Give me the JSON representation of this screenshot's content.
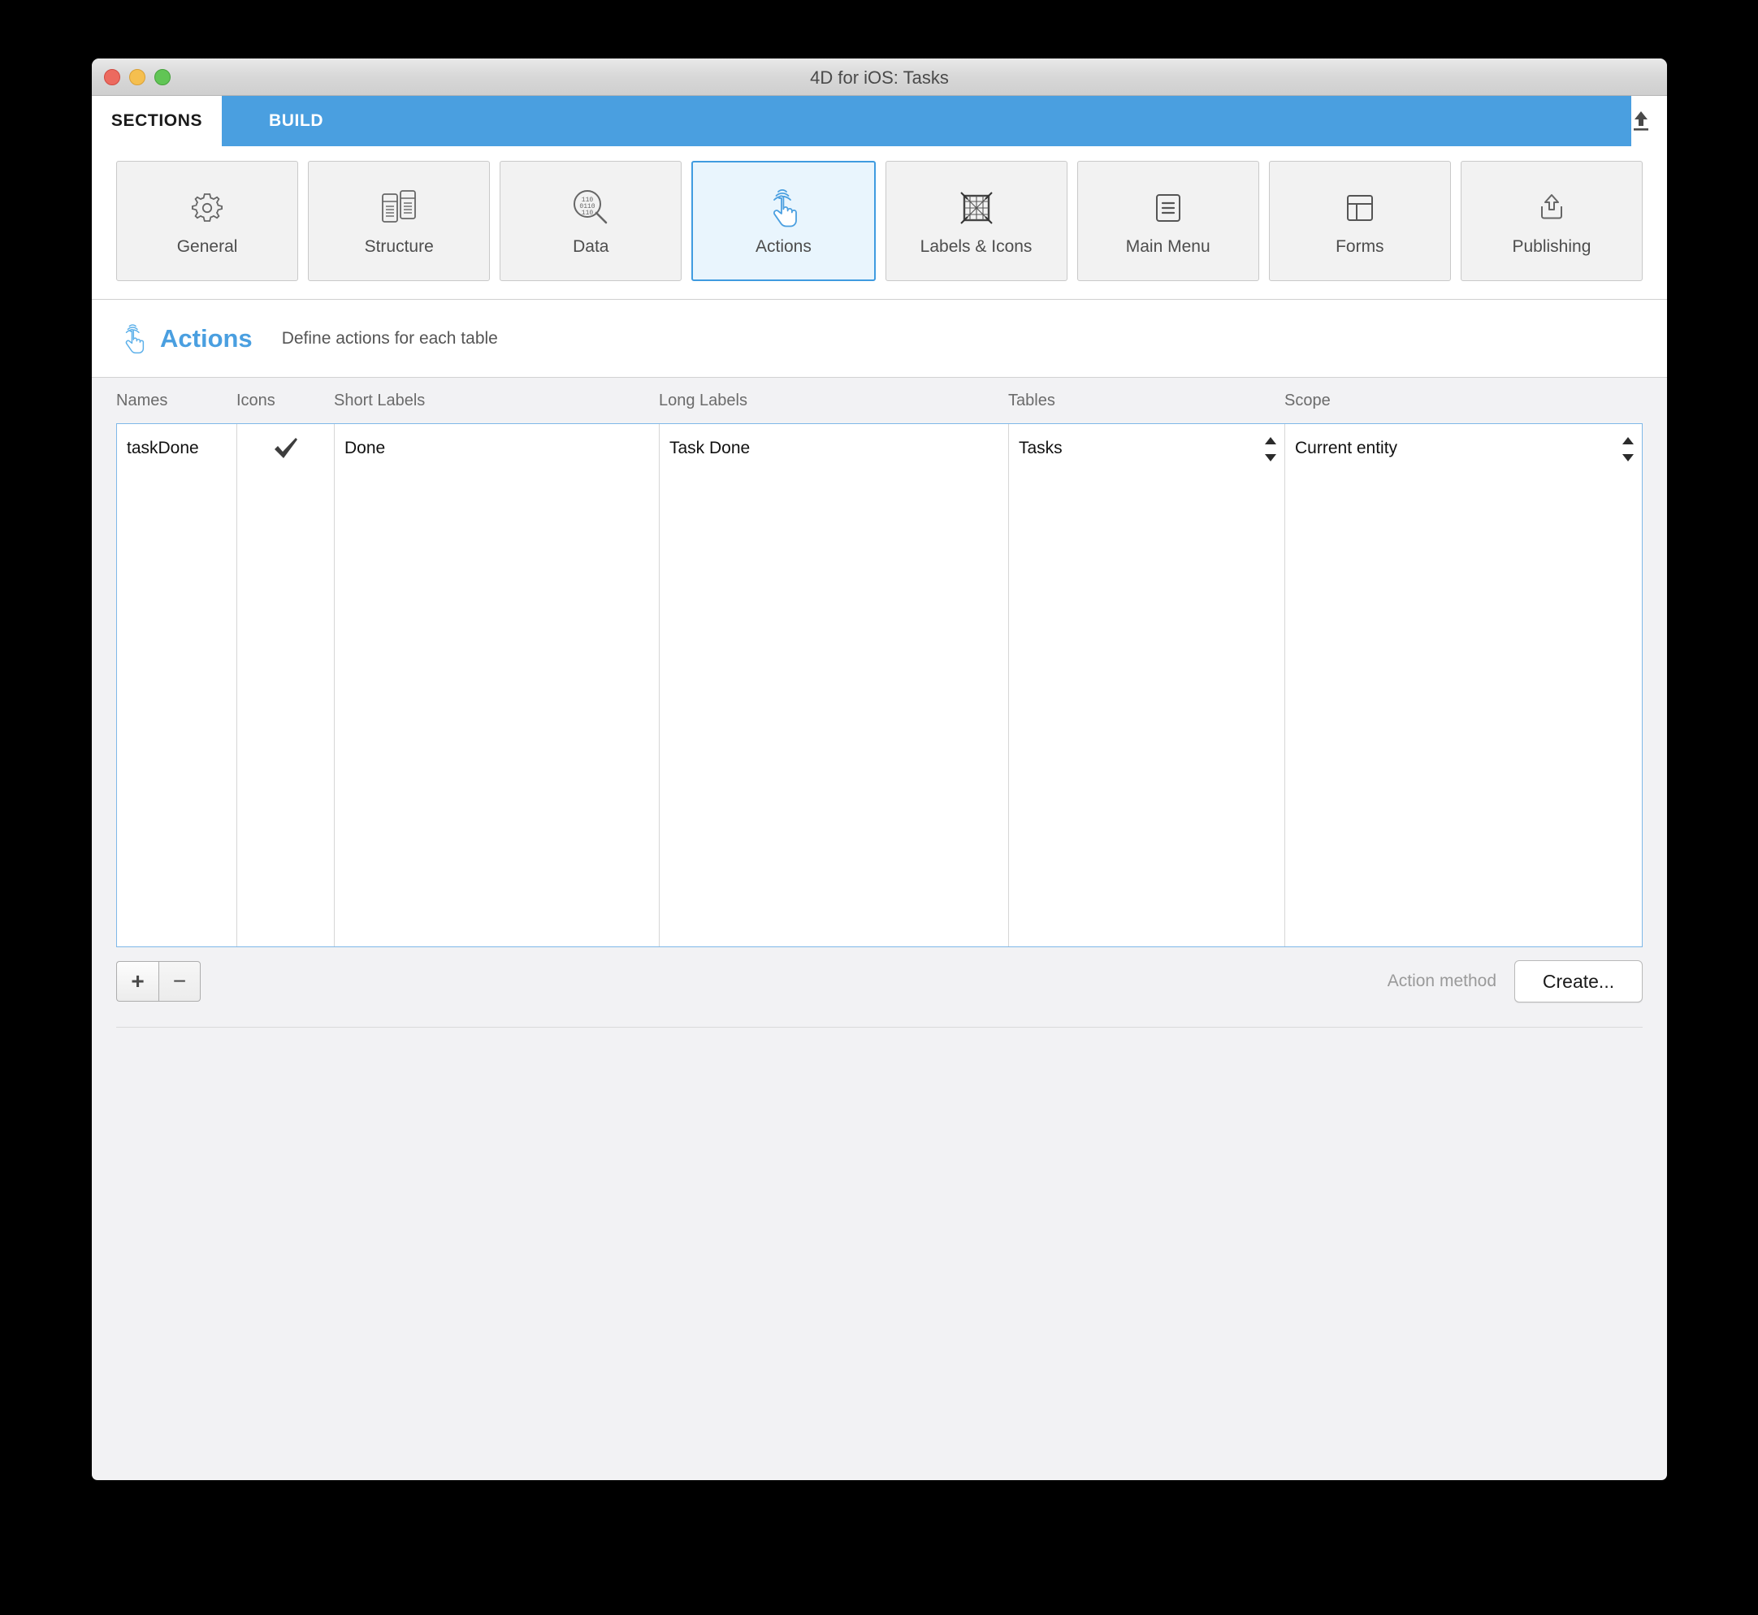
{
  "window": {
    "title": "4D for iOS: Tasks",
    "traffic_lights": [
      "close-button",
      "minimize-button",
      "zoom-button"
    ]
  },
  "tabs": [
    {
      "id": "sections",
      "label": "SECTIONS",
      "active": true
    },
    {
      "id": "build",
      "label": "BUILD",
      "active": false
    }
  ],
  "tabbar": {
    "upload_icon": "upload-icon",
    "accent_color": "#4a9fe0"
  },
  "sections": [
    {
      "id": "general",
      "label": "General",
      "icon": "gear-icon",
      "active": false
    },
    {
      "id": "structure",
      "label": "Structure",
      "icon": "structure-icon",
      "active": false
    },
    {
      "id": "data",
      "label": "Data",
      "icon": "data-search-icon",
      "active": false
    },
    {
      "id": "actions",
      "label": "Actions",
      "icon": "tap-hand-icon",
      "active": true
    },
    {
      "id": "labels-icons",
      "label": "Labels & Icons",
      "icon": "labels-icons-icon",
      "active": false
    },
    {
      "id": "main-menu",
      "label": "Main Menu",
      "icon": "list-document-icon",
      "active": false
    },
    {
      "id": "forms",
      "label": "Forms",
      "icon": "layout-icon",
      "active": false
    },
    {
      "id": "publishing",
      "label": "Publishing",
      "icon": "share-upload-icon",
      "active": false
    }
  ],
  "page_header": {
    "icon": "tap-hand-icon",
    "title": "Actions",
    "subtitle": "Define actions for each table",
    "title_color": "#4a9fe0"
  },
  "table": {
    "columns": [
      {
        "key": "names",
        "label": "Names"
      },
      {
        "key": "icons",
        "label": "Icons"
      },
      {
        "key": "short_labels",
        "label": "Short Labels"
      },
      {
        "key": "long_labels",
        "label": "Long Labels"
      },
      {
        "key": "tables",
        "label": "Tables"
      },
      {
        "key": "scope",
        "label": "Scope"
      }
    ],
    "rows": [
      {
        "names": "taskDone",
        "icons": "checkmark-icon",
        "short_labels": "Done",
        "long_labels": "Task Done",
        "tables": "Tasks",
        "scope": "Current entity"
      }
    ],
    "selection_border_color": "#7fb8e8"
  },
  "action_bar": {
    "add_label": "+",
    "remove_label": "−",
    "action_method_label": "Action method",
    "create_label": "Create..."
  }
}
